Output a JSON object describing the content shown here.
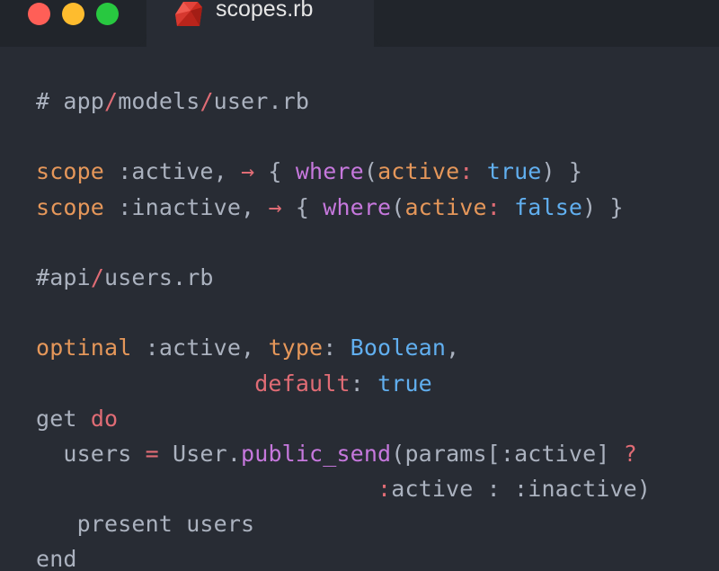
{
  "window": {
    "tab_title": "scopes.rb",
    "tab_icon": "ruby-icon",
    "accent": "#e06c75"
  },
  "code": {
    "lines": [
      [
        {
          "t": "# app",
          "c": "c-comment"
        },
        {
          "t": "/",
          "c": "c-slash"
        },
        {
          "t": "models",
          "c": "c-comment"
        },
        {
          "t": "/",
          "c": "c-slash"
        },
        {
          "t": "user.rb",
          "c": "c-comment"
        }
      ],
      [],
      [
        {
          "t": "scope",
          "c": "c-kw"
        },
        {
          "t": " :active, ",
          "c": "c-sym"
        },
        {
          "t": "→",
          "c": "c-arrow"
        },
        {
          "t": " { ",
          "c": "c-plain"
        },
        {
          "t": "where",
          "c": "c-fn"
        },
        {
          "t": "(",
          "c": "c-plain"
        },
        {
          "t": "active",
          "c": "c-param"
        },
        {
          "t": ": ",
          "c": "c-key"
        },
        {
          "t": "true",
          "c": "c-bool"
        },
        {
          "t": ") }",
          "c": "c-plain"
        }
      ],
      [
        {
          "t": "scope",
          "c": "c-kw"
        },
        {
          "t": " :inactive, ",
          "c": "c-sym"
        },
        {
          "t": "→",
          "c": "c-arrow"
        },
        {
          "t": " { ",
          "c": "c-plain"
        },
        {
          "t": "where",
          "c": "c-fn"
        },
        {
          "t": "(",
          "c": "c-plain"
        },
        {
          "t": "active",
          "c": "c-param"
        },
        {
          "t": ": ",
          "c": "c-key"
        },
        {
          "t": "false",
          "c": "c-bool"
        },
        {
          "t": ") }",
          "c": "c-plain"
        }
      ],
      [],
      [
        {
          "t": "#api",
          "c": "c-comment"
        },
        {
          "t": "/",
          "c": "c-slash"
        },
        {
          "t": "users.rb",
          "c": "c-comment"
        }
      ],
      [],
      [
        {
          "t": "optinal",
          "c": "c-kw"
        },
        {
          "t": " :active, ",
          "c": "c-sym"
        },
        {
          "t": "type",
          "c": "c-param"
        },
        {
          "t": ": ",
          "c": "c-plain"
        },
        {
          "t": "Boolean",
          "c": "c-const"
        },
        {
          "t": ",",
          "c": "c-plain"
        }
      ],
      [
        {
          "t": "                ",
          "c": "c-plain"
        },
        {
          "t": "default",
          "c": "c-key"
        },
        {
          "t": ": ",
          "c": "c-plain"
        },
        {
          "t": "true",
          "c": "c-bool"
        }
      ],
      [
        {
          "t": "get ",
          "c": "c-plain"
        },
        {
          "t": "do",
          "c": "c-key"
        }
      ],
      [
        {
          "t": "  users ",
          "c": "c-plain"
        },
        {
          "t": "=",
          "c": "c-op"
        },
        {
          "t": " User.",
          "c": "c-plain"
        },
        {
          "t": "public_send",
          "c": "c-fn"
        },
        {
          "t": "(params[:active] ",
          "c": "c-plain"
        },
        {
          "t": "?",
          "c": "c-op"
        }
      ],
      [
        {
          "t": "                         ",
          "c": "c-plain"
        },
        {
          "t": ":",
          "c": "c-op"
        },
        {
          "t": "active : :inactive)",
          "c": "c-plain"
        }
      ],
      [
        {
          "t": "   present users",
          "c": "c-plain"
        }
      ],
      [
        {
          "t": "end",
          "c": "c-plain"
        }
      ]
    ]
  }
}
